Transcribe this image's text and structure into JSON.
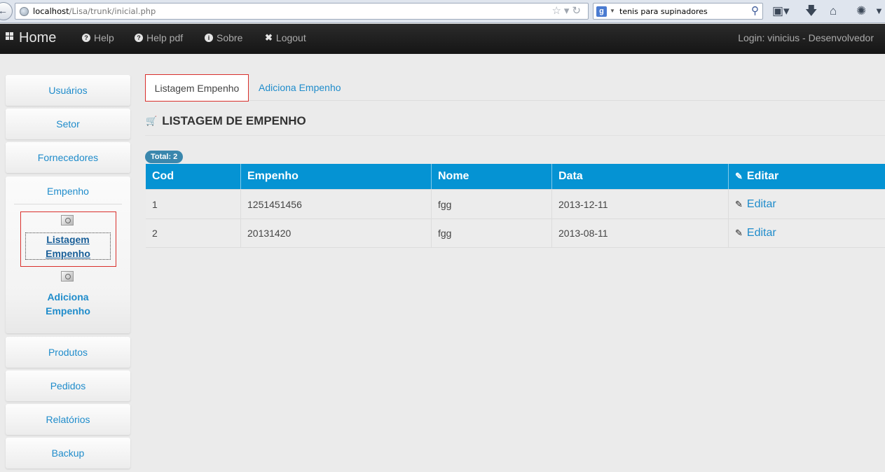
{
  "browser": {
    "url_host": "localhost",
    "url_path": "/Lisa/trunk/inicial.php",
    "search_value": "tenis para supinadores"
  },
  "navbar": {
    "brand": "Home",
    "links": [
      {
        "label": "Help",
        "icon": "question-circle-icon"
      },
      {
        "label": "Help pdf",
        "icon": "question-circle-icon"
      },
      {
        "label": "Sobre",
        "icon": "info-circle-icon"
      },
      {
        "label": "Logout",
        "icon": "close-icon"
      }
    ],
    "login_text": "Login: vinicius - Desenvolvedor"
  },
  "sidebar": {
    "items": [
      {
        "label": "Usuários"
      },
      {
        "label": "Setor"
      },
      {
        "label": "Fornecedores"
      },
      {
        "label": "Empenho"
      },
      {
        "label": "Produtos"
      },
      {
        "label": "Pedidos"
      },
      {
        "label": "Relatórios"
      },
      {
        "label": "Backup"
      }
    ],
    "submenu": [
      {
        "line1": "Listagem",
        "line2": "Empenho",
        "active": true
      },
      {
        "line1": "Adiciona",
        "line2": "Empenho",
        "active": false
      }
    ]
  },
  "tabs": [
    {
      "label": "Listagem Empenho",
      "active": true
    },
    {
      "label": "Adiciona Empenho",
      "active": false
    }
  ],
  "heading": "LISTAGEM DE EMPENHO",
  "total_badge": "Total: 2",
  "table": {
    "columns": [
      "Cod",
      "Empenho",
      "Nome",
      "Data",
      "Editar"
    ],
    "rows": [
      {
        "cod": "1",
        "empenho": "1251451456",
        "nome": "fgg",
        "data": "2013-12-11",
        "action": "Editar"
      },
      {
        "cod": "2",
        "empenho": "20131420",
        "nome": "fgg",
        "data": "2013-08-11",
        "action": "Editar"
      }
    ]
  },
  "colors": {
    "accent": "#1f8ccb",
    "table_header": "#0593d3",
    "navbar": "#1b1b1b",
    "highlight_border": "#d9302c",
    "badge": "#3a87ad"
  }
}
